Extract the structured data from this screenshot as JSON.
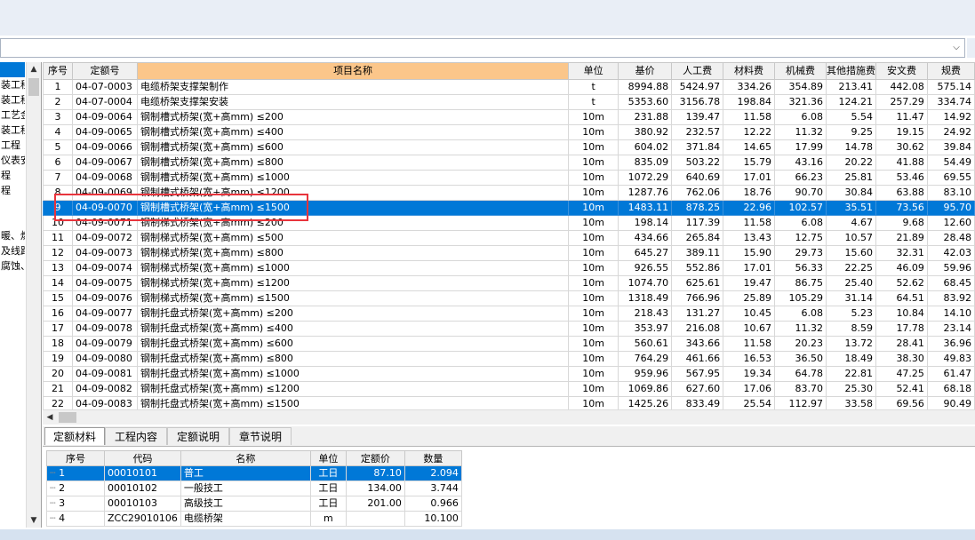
{
  "left_tree": {
    "items": [
      "",
      "装工程",
      "装工程",
      "工艺金",
      "装工程",
      "工程",
      "仪表安",
      "程",
      "程",
      "",
      "",
      "暖、燃",
      "及线路",
      "腐蚀、"
    ],
    "selected_index": 0,
    "scroll_up": "▲",
    "scroll_down": "▼"
  },
  "combo": {
    "value": "",
    "arrow": "⌵"
  },
  "quota_table": {
    "headers": [
      "序号",
      "定额号",
      "项目名称",
      "单位",
      "基价",
      "人工费",
      "材料费",
      "机械费",
      "其他措施费",
      "安文费",
      "规费"
    ],
    "selected_row": 8,
    "rows": [
      [
        "1",
        "04-07-0003",
        "电缆桥架支撑架制作",
        "t",
        "8994.88",
        "5424.97",
        "334.26",
        "354.89",
        "213.41",
        "442.08",
        "575.14"
      ],
      [
        "2",
        "04-07-0004",
        "电缆桥架支撑架安装",
        "t",
        "5353.60",
        "3156.78",
        "198.84",
        "321.36",
        "124.21",
        "257.29",
        "334.74"
      ],
      [
        "3",
        "04-09-0064",
        "钢制槽式桥架(宽+高mm) ≤200",
        "10m",
        "231.88",
        "139.47",
        "11.58",
        "6.08",
        "5.54",
        "11.47",
        "14.92"
      ],
      [
        "4",
        "04-09-0065",
        "钢制槽式桥架(宽+高mm) ≤400",
        "10m",
        "380.92",
        "232.57",
        "12.22",
        "11.32",
        "9.25",
        "19.15",
        "24.92"
      ],
      [
        "5",
        "04-09-0066",
        "钢制槽式桥架(宽+高mm) ≤600",
        "10m",
        "604.02",
        "371.84",
        "14.65",
        "17.99",
        "14.78",
        "30.62",
        "39.84"
      ],
      [
        "6",
        "04-09-0067",
        "钢制槽式桥架(宽+高mm) ≤800",
        "10m",
        "835.09",
        "503.22",
        "15.79",
        "43.16",
        "20.22",
        "41.88",
        "54.49"
      ],
      [
        "7",
        "04-09-0068",
        "钢制槽式桥架(宽+高mm) ≤1000",
        "10m",
        "1072.29",
        "640.69",
        "17.01",
        "66.23",
        "25.81",
        "53.46",
        "69.55"
      ],
      [
        "8",
        "04-09-0069",
        "钢制槽式桥架(宽+高mm) ≤1200",
        "10m",
        "1287.76",
        "762.06",
        "18.76",
        "90.70",
        "30.84",
        "63.88",
        "83.10"
      ],
      [
        "9",
        "04-09-0070",
        "钢制槽式桥架(宽+高mm) ≤1500",
        "10m",
        "1483.11",
        "878.25",
        "22.96",
        "102.57",
        "35.51",
        "73.56",
        "95.70"
      ],
      [
        "10",
        "04-09-0071",
        "钢制梯式桥架(宽+高mm) ≤200",
        "10m",
        "198.14",
        "117.39",
        "11.58",
        "6.08",
        "4.67",
        "9.68",
        "12.60"
      ],
      [
        "11",
        "04-09-0072",
        "钢制梯式桥架(宽+高mm) ≤500",
        "10m",
        "434.66",
        "265.84",
        "13.43",
        "12.75",
        "10.57",
        "21.89",
        "28.48"
      ],
      [
        "12",
        "04-09-0073",
        "钢制梯式桥架(宽+高mm) ≤800",
        "10m",
        "645.27",
        "389.11",
        "15.90",
        "29.73",
        "15.60",
        "32.31",
        "42.03"
      ],
      [
        "13",
        "04-09-0074",
        "钢制梯式桥架(宽+高mm) ≤1000",
        "10m",
        "926.55",
        "552.86",
        "17.01",
        "56.33",
        "22.25",
        "46.09",
        "59.96"
      ],
      [
        "14",
        "04-09-0075",
        "钢制梯式桥架(宽+高mm) ≤1200",
        "10m",
        "1074.70",
        "625.61",
        "19.47",
        "86.75",
        "25.40",
        "52.62",
        "68.45"
      ],
      [
        "15",
        "04-09-0076",
        "钢制梯式桥架(宽+高mm) ≤1500",
        "10m",
        "1318.49",
        "766.96",
        "25.89",
        "105.29",
        "31.14",
        "64.51",
        "83.92"
      ],
      [
        "16",
        "04-09-0077",
        "钢制托盘式桥架(宽+高mm) ≤200",
        "10m",
        "218.43",
        "131.27",
        "10.45",
        "6.08",
        "5.23",
        "10.84",
        "14.10"
      ],
      [
        "17",
        "04-09-0078",
        "钢制托盘式桥架(宽+高mm) ≤400",
        "10m",
        "353.97",
        "216.08",
        "10.67",
        "11.32",
        "8.59",
        "17.78",
        "23.14"
      ],
      [
        "18",
        "04-09-0079",
        "钢制托盘式桥架(宽+高mm) ≤600",
        "10m",
        "560.61",
        "343.66",
        "11.58",
        "20.23",
        "13.72",
        "28.41",
        "36.96"
      ],
      [
        "19",
        "04-09-0080",
        "钢制托盘式桥架(宽+高mm) ≤800",
        "10m",
        "764.29",
        "461.66",
        "16.53",
        "36.50",
        "18.49",
        "38.30",
        "49.83"
      ],
      [
        "20",
        "04-09-0081",
        "钢制托盘式桥架(宽+高mm) ≤1000",
        "10m",
        "959.96",
        "567.95",
        "19.34",
        "64.78",
        "22.81",
        "47.25",
        "61.47"
      ],
      [
        "21",
        "04-09-0082",
        "钢制托盘式桥架(宽+高mm) ≤1200",
        "10m",
        "1069.86",
        "627.60",
        "17.06",
        "83.70",
        "25.30",
        "52.41",
        "68.18"
      ],
      [
        "22",
        "04-09-0083",
        "钢制托盘式桥架(宽+高mm) ≤1500",
        "10m",
        "1425.26",
        "833.49",
        "25.54",
        "112.97",
        "33.58",
        "69.56",
        "90.49"
      ]
    ]
  },
  "hscroll": {
    "left_arrow": "◀"
  },
  "tabs": [
    {
      "label": "定额材料",
      "active": true
    },
    {
      "label": "工程内容",
      "active": false
    },
    {
      "label": "定额说明",
      "active": false
    },
    {
      "label": "章节说明",
      "active": false
    }
  ],
  "material_table": {
    "headers": [
      "序号",
      "代码",
      "名称",
      "单位",
      "定额价",
      "数量"
    ],
    "selected_row": 0,
    "rows": [
      [
        "1",
        "00010101",
        "普工",
        "工日",
        "87.10",
        "2.094"
      ],
      [
        "2",
        "00010102",
        "一般技工",
        "工日",
        "134.00",
        "3.744"
      ],
      [
        "3",
        "00010103",
        "高级技工",
        "工日",
        "201.00",
        "0.966"
      ],
      [
        "4",
        "ZCC29010106",
        "电缆桥架",
        "m",
        "",
        "10.100"
      ]
    ]
  },
  "colors": {
    "selection": "#0078d7",
    "header_highlight": "#fbc68a",
    "annotation_box": "#e8343c"
  }
}
